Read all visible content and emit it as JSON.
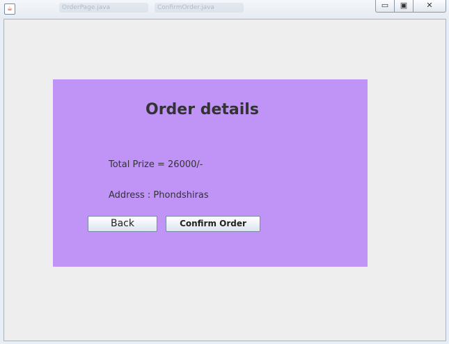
{
  "titlebar": {
    "app_icon": "java-icon",
    "blurred_tabs": [
      "OrderPage.java",
      "ConfirmOrder.java"
    ],
    "minimize": "▭",
    "maximize": "▣",
    "close": "✕"
  },
  "panel": {
    "background": "#bf94f6",
    "title": "Order details",
    "total_text": "Total Prize = 26000/-",
    "address_text": "Address : Phondshiras"
  },
  "buttons": {
    "back": "Back",
    "confirm": "Confirm Order"
  }
}
